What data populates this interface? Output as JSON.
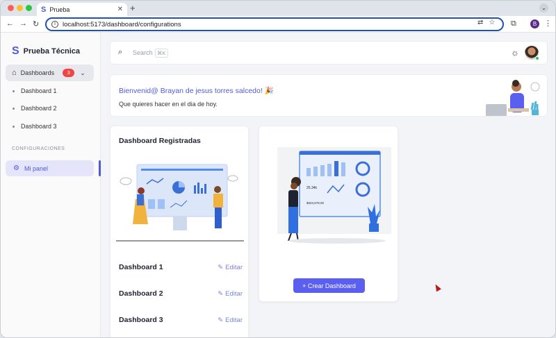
{
  "browser": {
    "tab_title": "Prueba",
    "url": "localhost:5173/dashboard/configurations",
    "profile_initial": "B"
  },
  "sidebar": {
    "brand": "Prueba Técnica",
    "dashboards_label": "Dashboards",
    "dashboards_badge": "3",
    "sub_items": [
      {
        "label": "Dashboard 1"
      },
      {
        "label": "Dashboard 2"
      },
      {
        "label": "Dashboard 3"
      }
    ],
    "section_label": "CONFIGURACIONES",
    "panel_label": "Mi panel"
  },
  "topbar": {
    "search_placeholder": "Search",
    "search_shortcut": "⌘K"
  },
  "welcome": {
    "title": "Bienvenid@ Brayan de jesus torres salcedo! 🎉",
    "subtitle": "Que quieres hacer en el dia de hoy."
  },
  "registered_card": {
    "title": "Dashboard Registradas",
    "edit_label": "Editar",
    "rows": [
      {
        "name": "Dashboard 1"
      },
      {
        "name": "Dashboard 2"
      },
      {
        "name": "Dashboard 3"
      }
    ]
  },
  "create_card": {
    "button_label": "+ Crear Dashboard",
    "art_text_1": "25.34k",
    "art_text_2": "$323,678.00"
  },
  "colors": {
    "accent": "#4f5bd5",
    "button": "#5b5ff0",
    "badge": "#ef4444"
  },
  "icons": [
    "home-icon",
    "gear-icon",
    "search-icon",
    "sun-icon",
    "edit-icon",
    "chevron-down-icon"
  ]
}
